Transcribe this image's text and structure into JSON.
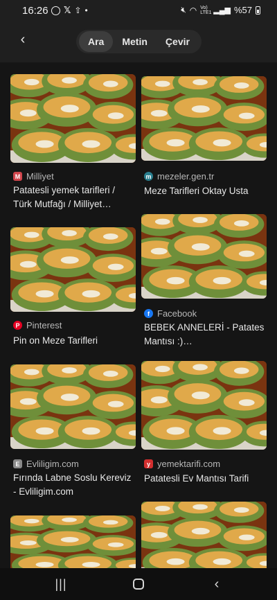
{
  "status_bar": {
    "time": "16:26",
    "left_icons": [
      "whatsapp-icon",
      "x-icon",
      "share-icon",
      "dot-icon"
    ],
    "right_text": "%57",
    "network_label": "Vo) LTE1"
  },
  "toolbar": {
    "back_icon": "arrow-back-icon",
    "tabs": [
      {
        "label": "Ara",
        "active": true
      },
      {
        "label": "Metin",
        "active": false
      },
      {
        "label": "Çevir",
        "active": false
      }
    ]
  },
  "results": [
    {
      "source": "Milliyet",
      "favicon_color": "#d0454c",
      "favicon_letter": "M",
      "title": "Patatesli yemek tarifleri / Türk Mutfağı / Milliyet…"
    },
    {
      "source": "mezeler.gen.tr",
      "favicon_color": "#2a7f8f",
      "favicon_letter": "m",
      "title": "Meze Tarifleri Oktay Usta"
    },
    {
      "source": "Pinterest",
      "favicon_color": "#e60023",
      "favicon_letter": "P",
      "title": "Pin on Meze Tarifleri"
    },
    {
      "source": "Facebook",
      "favicon_color": "#1877f2",
      "favicon_letter": "f",
      "title": "BEBEK ANNELERİ - Patates Mantısı :)…"
    },
    {
      "source": "Evliligim.com",
      "favicon_color": "#8a8a8a",
      "favicon_letter": "E",
      "title": "Fırında Labne Soslu Kereviz - Evliligim.com"
    },
    {
      "source": "yemektarifi.com",
      "favicon_color": "#d32f2f",
      "favicon_letter": "y",
      "title": "Patatesli Ev Mantısı Tarifi"
    },
    {
      "source": "",
      "favicon_color": "",
      "favicon_letter": "",
      "title": ""
    },
    {
      "source": "",
      "favicon_color": "",
      "favicon_letter": "",
      "title": ""
    }
  ],
  "navbar": {
    "recents_icon": "recents-icon",
    "home_icon": "home-icon",
    "back_icon": "back-icon"
  }
}
